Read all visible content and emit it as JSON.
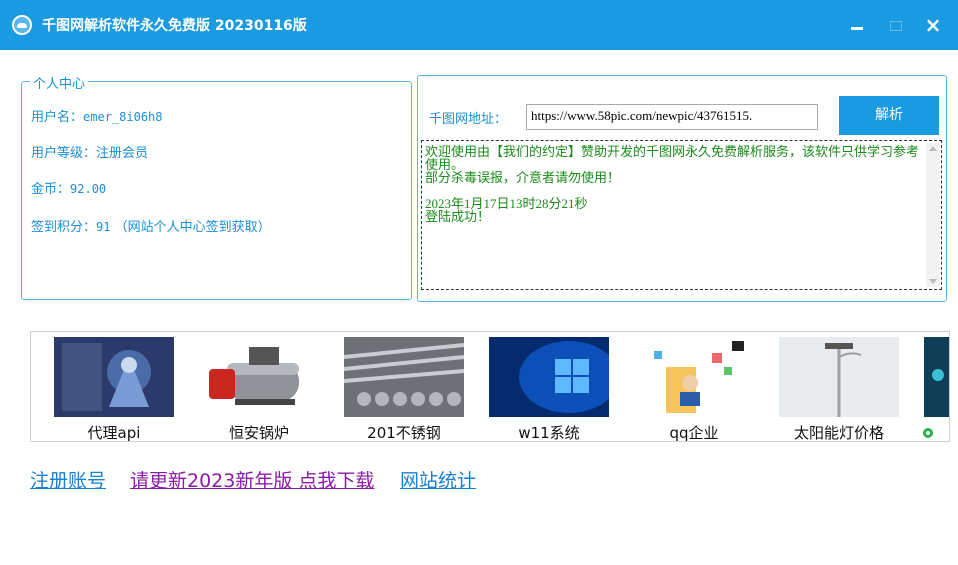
{
  "window": {
    "title": "千图网解析软件永久免费版 20230116版",
    "minimize": "‒",
    "maximize": "□",
    "close": "×"
  },
  "user_center": {
    "legend": "个人中心",
    "username_label": "用户名：",
    "username": "emer_8i06h8",
    "level_label": "用户等级：",
    "level": "注册会员",
    "coins_label": "金币：",
    "coins": "92.00",
    "points_label": "签到积分：",
    "points": "91",
    "points_note": " （网站个人中心签到获取）"
  },
  "parser": {
    "url_label": "千图网地址：",
    "url_value": "https://www.58pic.com/newpic/43761515.",
    "parse_button": "解析",
    "log": [
      "欢迎使用由【我们的约定】赞助开发的千图网永久免费解析服务，该软件只供学习参考使用。",
      "部分杀毒误报，介意者请勿使用！",
      "",
      "2023年1月17日13时28分21秒",
      "登陆成功！"
    ]
  },
  "ads": [
    {
      "label": "代理api",
      "icon": "game-character-image"
    },
    {
      "label": "恒安锅炉",
      "icon": "boiler-image"
    },
    {
      "label": "201不锈钢",
      "icon": "steel-bars-image"
    },
    {
      "label": "w11系统",
      "icon": "windows-logo-image"
    },
    {
      "label": "qq企业",
      "icon": "business-avatar-image"
    },
    {
      "label": "太阳能灯价格",
      "icon": "solar-street-lamp-image"
    }
  ],
  "links": {
    "register": "注册账号",
    "update": "请更新2023新年版 点我下载",
    "stats": "网站统计"
  },
  "colors": {
    "accent": "#1a9ae0",
    "label_text": "#1a8fd6",
    "log_text": "#1a8a1a",
    "visited_link": "#8b1aa6"
  }
}
